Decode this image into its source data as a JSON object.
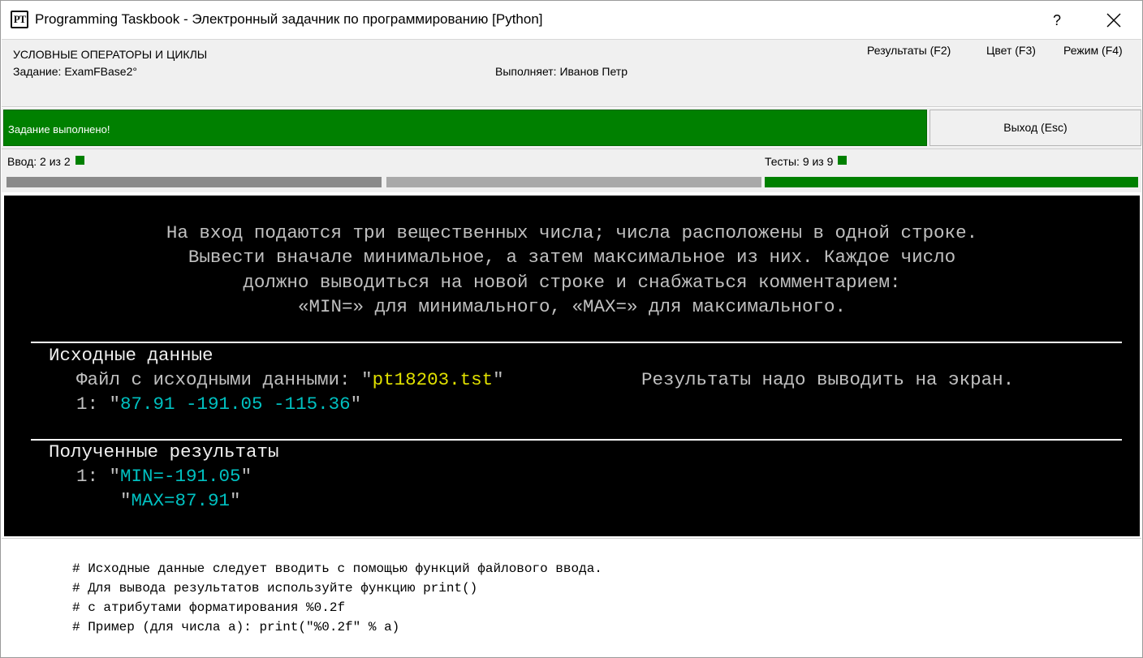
{
  "window": {
    "title": "Programming Taskbook - Электронный задачник по программированию [Python]",
    "icon_text": "PT",
    "help_label": "?"
  },
  "header": {
    "section": "УСЛОВНЫЕ ОПЕРАТОРЫ И ЦИКЛЫ",
    "task_label": "Задание: ExamFBase2°",
    "performer_label": "Выполняет: Иванов Петр",
    "menu": [
      {
        "label": "Результаты (F2)"
      },
      {
        "label": "Цвет (F3)"
      },
      {
        "label": "Режим (F4)"
      }
    ]
  },
  "status": {
    "message": "Задание выполнено!",
    "exit_label": "Выход (Esc)",
    "color": "#008000"
  },
  "progress": {
    "input_label": "Ввод:",
    "input_value": "2 из 2",
    "tests_label": "Тесты:",
    "tests_value": "9 из 9"
  },
  "console": {
    "task_lines": [
      "На вход подаются три вещественных числа; числа расположены в одной строке.",
      "Вывести вначале минимальное, а затем максимальное из них. Каждое число",
      "должно выводиться на новой строке и снабжаться комментарием:",
      "«MIN=» для минимального, «MAX=» для максимального."
    ],
    "input_section": {
      "title": "Исходные данные",
      "file_prefix": "Файл с исходными данными: ",
      "quote": "\"",
      "file_name": "pt18203.tst",
      "screen_note": "Результаты надо выводить на экран.",
      "line_number": "1: ",
      "line_value": "87.91 -191.05 -115.36"
    },
    "output_section": {
      "title": "Полученные результаты",
      "line_number": "1: ",
      "lines": [
        "MIN=-191.05",
        "MAX=87.91"
      ]
    },
    "colors": {
      "background": "#000000",
      "text": "#c0c0c0",
      "data": "#00c0c0",
      "file": "#e0e000"
    }
  },
  "hints": [
    "# Исходные данные следует вводить с помощью функций файлового ввода.",
    "# Для вывода результатов используйте функцию print()",
    "# с атрибутами форматирования %0.2f",
    "# Пример (для числа a): print(\"%0.2f\" % a)"
  ]
}
